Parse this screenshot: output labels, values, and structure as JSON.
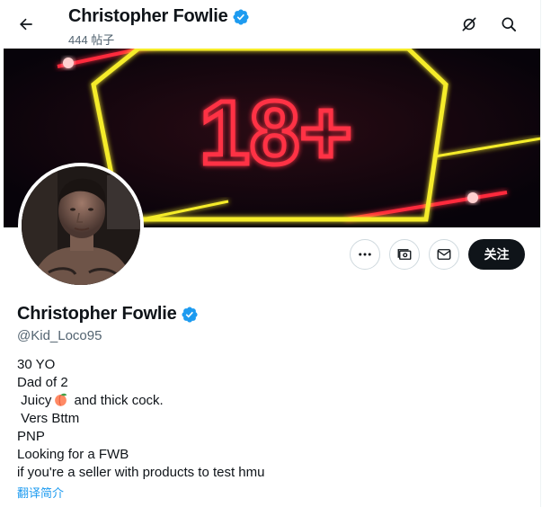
{
  "header": {
    "name": "Christopher Fowlie",
    "post_count": "444 帖子"
  },
  "banner": {
    "text": "18+"
  },
  "actions": {
    "follow_label": "关注"
  },
  "profile": {
    "name": "Christopher Fowlie",
    "handle": "@Kid_Loco95",
    "bio_lines": [
      "30 YO",
      "Dad of 2",
      " Juicy",
      " and thick cock.",
      " Vers Bttm",
      "PNP",
      "Looking for a FWB",
      "if you're a seller with products to test hmu"
    ],
    "translate_label": "翻译简介"
  },
  "colors": {
    "accent": "#1d9bf0",
    "text": "#0f1419",
    "muted": "#536471",
    "border": "#cfd9de",
    "neon_red": "#ff2a3c",
    "neon_yellow": "#f5ec2a"
  },
  "icons": {
    "back": "arrow-left-icon",
    "grok": "grok-slash-icon",
    "search": "search-icon",
    "more": "more-dots-icon",
    "subscribe": "money-icon",
    "message": "envelope-icon",
    "verified": "verified-badge-icon",
    "peach": "peach-emoji-icon"
  }
}
